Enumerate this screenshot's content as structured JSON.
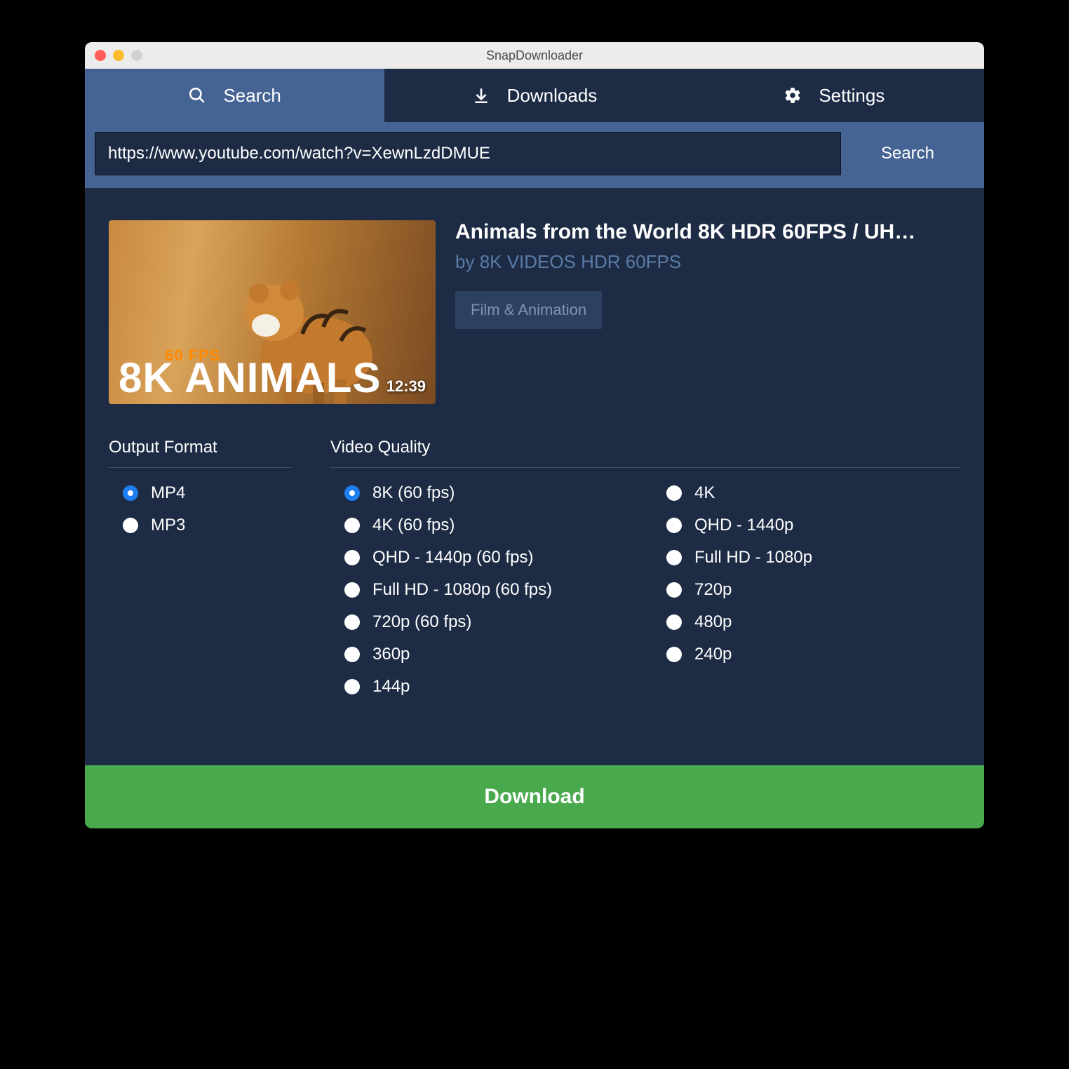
{
  "window": {
    "title": "SnapDownloader"
  },
  "tabs": [
    {
      "label": "Search",
      "icon": "search-icon",
      "active": true
    },
    {
      "label": "Downloads",
      "icon": "download-icon",
      "active": false
    },
    {
      "label": "Settings",
      "icon": "gear-icon",
      "active": false
    }
  ],
  "search": {
    "url": "https://www.youtube.com/watch?v=XewnLzdDMUE",
    "button": "Search"
  },
  "video": {
    "title": "Animals from the World 8K HDR 60FPS / UH…",
    "author_prefix": "by ",
    "author": "8K VIDEOS HDR 60FPS",
    "category": "Film & Animation",
    "duration": "12:39",
    "thumb_text_fps": "60 FPS",
    "thumb_text_big": "8K ANIMALS"
  },
  "format": {
    "heading": "Output Format",
    "options": [
      {
        "label": "MP4",
        "selected": true
      },
      {
        "label": "MP3",
        "selected": false
      }
    ]
  },
  "quality": {
    "heading": "Video Quality",
    "col1": [
      {
        "label": "8K (60 fps)",
        "selected": true
      },
      {
        "label": "4K (60 fps)",
        "selected": false
      },
      {
        "label": "QHD - 1440p (60 fps)",
        "selected": false
      },
      {
        "label": "Full HD - 1080p (60 fps)",
        "selected": false
      },
      {
        "label": "720p (60 fps)",
        "selected": false
      },
      {
        "label": "360p",
        "selected": false
      },
      {
        "label": "144p",
        "selected": false
      }
    ],
    "col2": [
      {
        "label": "4K",
        "selected": false
      },
      {
        "label": "QHD - 1440p",
        "selected": false
      },
      {
        "label": "Full HD - 1080p",
        "selected": false
      },
      {
        "label": "720p",
        "selected": false
      },
      {
        "label": "480p",
        "selected": false
      },
      {
        "label": "240p",
        "selected": false
      }
    ]
  },
  "download_label": "Download"
}
